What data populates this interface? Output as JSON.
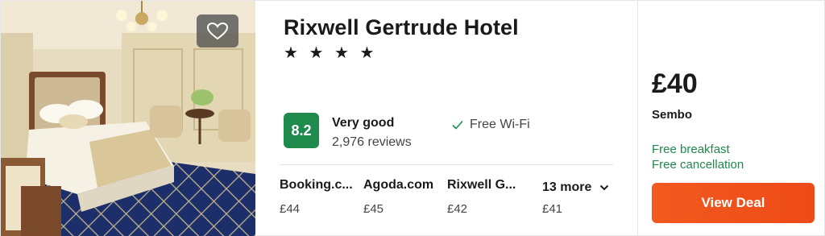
{
  "hotel": {
    "name": "Rixwell Gertrude Hotel",
    "stars": "★ ★ ★ ★",
    "star_count": 4,
    "rating_score": "8.2",
    "rating_word": "Very good",
    "reviews": "2,976 reviews",
    "amenity": "Free Wi-Fi",
    "photo_alt": "hotel-room-photo",
    "favorite_icon": "heart-icon"
  },
  "providers": [
    {
      "name": "Booking.c...",
      "price": "£44"
    },
    {
      "name": "Agoda.com",
      "price": "£45"
    },
    {
      "name": "Rixwell G...",
      "price": "£42"
    }
  ],
  "more": {
    "label": "13 more",
    "price": "£41",
    "icon": "chevron-down-icon"
  },
  "deal": {
    "price": "£40",
    "site": "Sembo",
    "perks": [
      "Free breakfast",
      "Free cancellation"
    ],
    "button_label": "View Deal"
  },
  "colors": {
    "score_bg": "#1e8a4c",
    "perk_text": "#1e8a4c",
    "button_orange": "#f25a1f"
  }
}
